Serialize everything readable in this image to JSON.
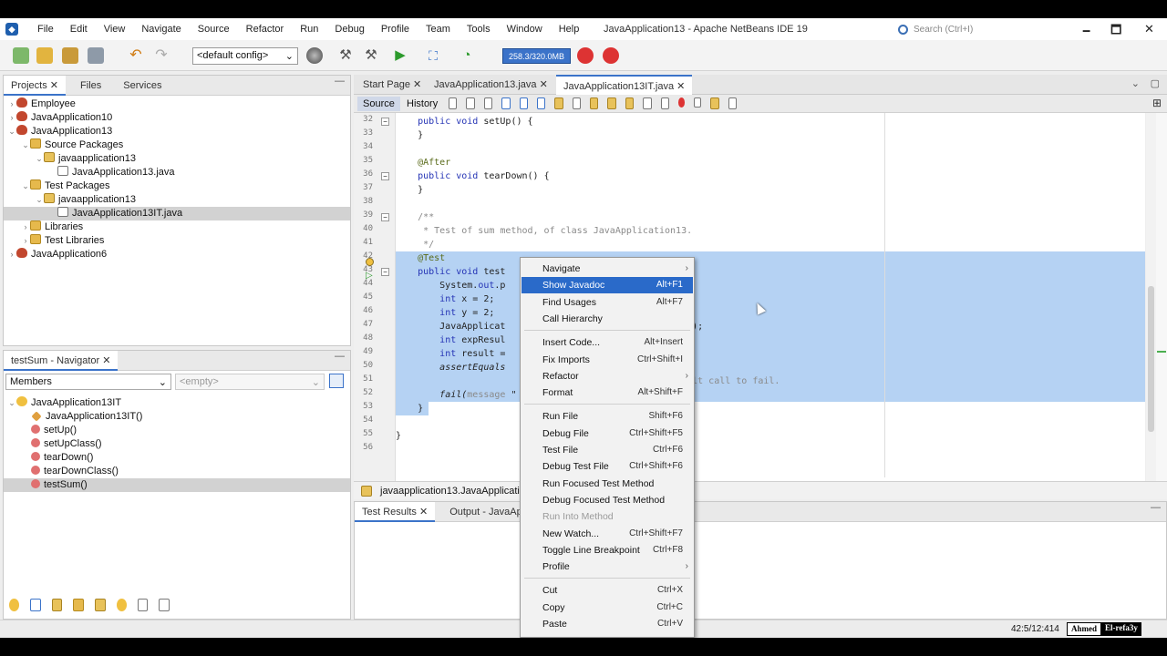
{
  "window": {
    "title": "JavaApplication13 - Apache NetBeans IDE 19",
    "search_placeholder": "Search (Ctrl+I)",
    "minimize": "🗕",
    "maximize": "🗖",
    "close": "✕"
  },
  "menubar": [
    "File",
    "Edit",
    "View",
    "Navigate",
    "Source",
    "Refactor",
    "Run",
    "Debug",
    "Profile",
    "Team",
    "Tools",
    "Window",
    "Help"
  ],
  "toolbar": {
    "config": "<default config>",
    "memory": "258.3/320.0MB"
  },
  "projects_panel": {
    "tabs": [
      "Projects",
      "Files",
      "Services"
    ],
    "tree": [
      {
        "label": "Employee"
      },
      {
        "label": "JavaApplication10"
      },
      {
        "label": "JavaApplication13"
      },
      {
        "label": "Source Packages"
      },
      {
        "label": "javaapplication13"
      },
      {
        "label": "JavaApplication13.java"
      },
      {
        "label": "Test Packages"
      },
      {
        "label": "javaapplication13"
      },
      {
        "label": "JavaApplication13IT.java"
      },
      {
        "label": "Libraries"
      },
      {
        "label": "Test Libraries"
      },
      {
        "label": "JavaApplication6"
      }
    ]
  },
  "navigator": {
    "title": "testSum - Navigator",
    "filter": "Members",
    "empty": "<empty>",
    "tree": [
      {
        "label": "JavaApplication13IT"
      },
      {
        "label": "JavaApplication13IT()"
      },
      {
        "label": "setUp()"
      },
      {
        "label": "setUpClass()"
      },
      {
        "label": "tearDown()"
      },
      {
        "label": "tearDownClass()"
      },
      {
        "label": "testSum()"
      }
    ]
  },
  "editor": {
    "tabs": [
      "Start Page",
      "JavaApplication13.java",
      "JavaApplication13IT.java"
    ],
    "source_tab": "Source",
    "history_tab": "History",
    "lines": [
      {
        "n": "32",
        "segs": [
          {
            "t": "    "
          },
          {
            "t": "public void ",
            "c": "kw"
          },
          {
            "t": "setUp() {"
          }
        ]
      },
      {
        "n": "33",
        "segs": [
          {
            "t": "    }"
          }
        ]
      },
      {
        "n": "34",
        "segs": [
          {
            "t": ""
          }
        ]
      },
      {
        "n": "35",
        "segs": [
          {
            "t": "    @After",
            "c": "an"
          }
        ]
      },
      {
        "n": "36",
        "segs": [
          {
            "t": "    "
          },
          {
            "t": "public void ",
            "c": "kw"
          },
          {
            "t": "tearDown() {"
          }
        ]
      },
      {
        "n": "37",
        "segs": [
          {
            "t": "    }"
          }
        ]
      },
      {
        "n": "38",
        "segs": [
          {
            "t": ""
          }
        ]
      },
      {
        "n": "39",
        "segs": [
          {
            "t": "    /**",
            "c": "cm"
          }
        ]
      },
      {
        "n": "40",
        "segs": [
          {
            "t": "     * Test of sum method, of class JavaApplication13.",
            "c": "cm"
          }
        ]
      },
      {
        "n": "41",
        "segs": [
          {
            "t": "     */",
            "c": "cm"
          }
        ]
      },
      {
        "n": "42",
        "hl": true,
        "segs": [
          {
            "t": "    @Test",
            "c": "an"
          }
        ]
      },
      {
        "n": "43",
        "hl": true,
        "segs": [
          {
            "t": "    "
          },
          {
            "t": "public void ",
            "c": "kw"
          },
          {
            "t": "test"
          }
        ]
      },
      {
        "n": "44",
        "hl": true,
        "segs": [
          {
            "t": "        System."
          },
          {
            "t": "out",
            "c": "kw"
          },
          {
            "t": ".p"
          }
        ]
      },
      {
        "n": "45",
        "hl": true,
        "segs": [
          {
            "t": "        "
          },
          {
            "t": "int",
            "c": "kw"
          },
          {
            "t": " x = 2;"
          }
        ]
      },
      {
        "n": "46",
        "hl": true,
        "segs": [
          {
            "t": "        "
          },
          {
            "t": "int",
            "c": "kw"
          },
          {
            "t": " y = 2;"
          }
        ]
      },
      {
        "n": "47",
        "hl": true,
        "segs": [
          {
            "t": "        JavaApplicat                      plication13();"
          }
        ]
      },
      {
        "n": "48",
        "hl": true,
        "segs": [
          {
            "t": "        "
          },
          {
            "t": "int",
            "c": "kw"
          },
          {
            "t": " expResul"
          }
        ]
      },
      {
        "n": "49",
        "hl": true,
        "segs": [
          {
            "t": "        "
          },
          {
            "t": "int",
            "c": "kw"
          },
          {
            "t": " result ="
          }
        ]
      },
      {
        "n": "50",
        "hl": true,
        "segs": [
          {
            "t": "        "
          },
          {
            "t": "assertEquals",
            "c": "it"
          },
          {
            "t": "                         t);"
          }
        ]
      },
      {
        "n": "51",
        "hl": true,
        "segs": [
          {
            "t": "                                      remove the default call to fail.",
            "c": "cm"
          }
        ]
      },
      {
        "n": "52",
        "hl": true,
        "segs": [
          {
            "t": "        "
          },
          {
            "t": "fail(",
            "c": "it"
          },
          {
            "t": "message",
            "c": "cm"
          },
          {
            "t": " \"                       \");"
          }
        ]
      },
      {
        "n": "53",
        "hl": true,
        "segs": [
          {
            "t": "    }"
          }
        ]
      },
      {
        "n": "54",
        "segs": [
          {
            "t": ""
          }
        ]
      },
      {
        "n": "55",
        "segs": [
          {
            "t": "}"
          }
        ]
      },
      {
        "n": "56",
        "segs": [
          {
            "t": ""
          }
        ]
      }
    ],
    "breadcrumb": "javaapplication13.JavaApplication1"
  },
  "context_menu": {
    "items": [
      {
        "label": "Navigate",
        "shortcut": "",
        "sub": true
      },
      {
        "label": "Show Javadoc",
        "shortcut": "Alt+F1",
        "hover": true
      },
      {
        "label": "Find Usages",
        "shortcut": "Alt+F7"
      },
      {
        "label": "Call Hierarchy",
        "shortcut": ""
      },
      {
        "sep": true
      },
      {
        "label": "Insert Code...",
        "shortcut": "Alt+Insert"
      },
      {
        "label": "Fix Imports",
        "shortcut": "Ctrl+Shift+I"
      },
      {
        "label": "Refactor",
        "shortcut": "",
        "sub": true
      },
      {
        "label": "Format",
        "shortcut": "Alt+Shift+F"
      },
      {
        "sep": true
      },
      {
        "label": "Run File",
        "shortcut": "Shift+F6"
      },
      {
        "label": "Debug File",
        "shortcut": "Ctrl+Shift+F5"
      },
      {
        "label": "Test File",
        "shortcut": "Ctrl+F6"
      },
      {
        "label": "Debug Test File",
        "shortcut": "Ctrl+Shift+F6"
      },
      {
        "label": "Run Focused Test Method",
        "shortcut": ""
      },
      {
        "label": "Debug Focused Test Method",
        "shortcut": ""
      },
      {
        "label": "Run Into Method",
        "shortcut": "",
        "disabled": true
      },
      {
        "label": "New Watch...",
        "shortcut": "Ctrl+Shift+F7"
      },
      {
        "label": "Toggle Line Breakpoint",
        "shortcut": "Ctrl+F8"
      },
      {
        "label": "Profile",
        "shortcut": "",
        "sub": true
      },
      {
        "sep": true
      },
      {
        "label": "Cut",
        "shortcut": "Ctrl+X"
      },
      {
        "label": "Copy",
        "shortcut": "Ctrl+C"
      },
      {
        "label": "Paste",
        "shortcut": "Ctrl+V"
      }
    ]
  },
  "bottom_panel": {
    "tabs": [
      "Test Results",
      "Output - JavaApplicat"
    ]
  },
  "status": {
    "position": "42:5/12:414",
    "watermark_a": "Ahmed",
    "watermark_b": "El-refa3y"
  },
  "colors": {
    "accent": "#3b73c9",
    "selection": "#b5d2f3",
    "menu_hover": "#2a6ac9"
  }
}
